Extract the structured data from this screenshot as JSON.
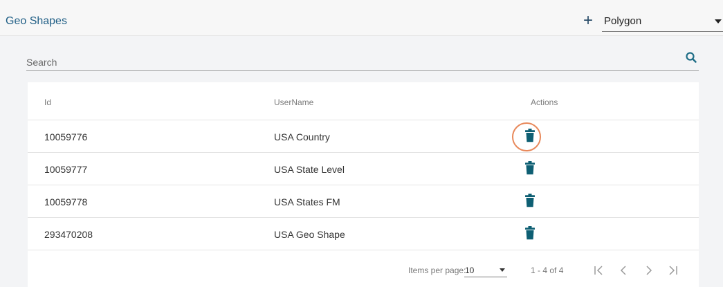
{
  "header": {
    "title": "Geo Shapes",
    "add_icon": "plus-icon",
    "shape_type": {
      "value": "Polygon"
    }
  },
  "search": {
    "placeholder": "Search",
    "value": "",
    "icon": "search-icon"
  },
  "table": {
    "columns": [
      "Id",
      "UserName",
      "Actions"
    ],
    "rows": [
      {
        "id": "10059776",
        "username": "USA Country",
        "action_icon": "trash-icon",
        "highlighted": true
      },
      {
        "id": "10059777",
        "username": "USA State Level",
        "action_icon": "trash-icon"
      },
      {
        "id": "10059778",
        "username": "USA States FM",
        "action_icon": "trash-icon"
      },
      {
        "id": "293470208",
        "username": "USA Geo Shape",
        "action_icon": "trash-icon"
      }
    ]
  },
  "pagination": {
    "items_per_page_label": "Items per page:",
    "items_per_page": "10",
    "range": "1 - 4 of 4"
  },
  "colors": {
    "accent": "#1f5e85",
    "action_icon": "#0e5f73",
    "highlight_ring": "#e8885a"
  }
}
